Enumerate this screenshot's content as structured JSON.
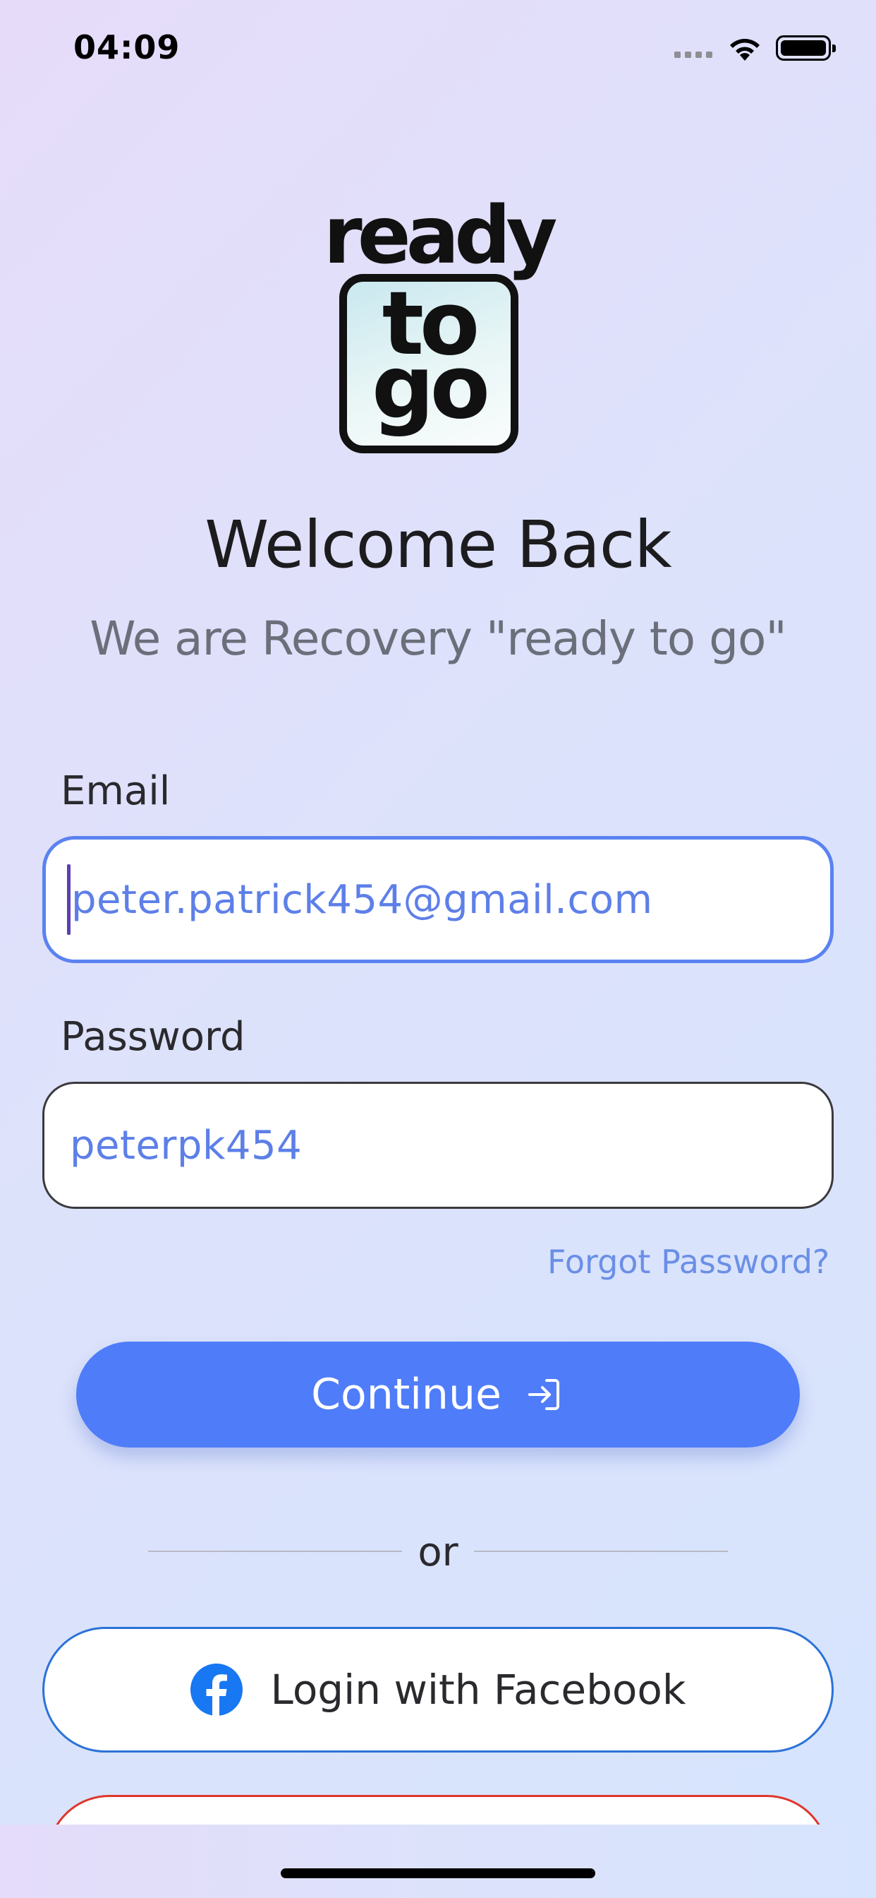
{
  "status_bar": {
    "time": "04:09"
  },
  "logo": {
    "top_word": "ready",
    "box_line1": "to",
    "box_line2": "go"
  },
  "header": {
    "title": "Welcome Back",
    "subtitle": "We are Recovery \"ready to go\""
  },
  "form": {
    "email_label": "Email",
    "email_value": "peter.patrick454@gmail.com",
    "password_label": "Password",
    "password_value": "peterpk454",
    "forgot_password": "Forgot Password?"
  },
  "continue_button": {
    "label": "Continue",
    "icon": "login-arrow-icon"
  },
  "divider": {
    "text": "or"
  },
  "social": {
    "facebook_label": "Login with Facebook",
    "facebook_icon": "facebook-icon"
  },
  "colors": {
    "accent": "#4f7cf8",
    "link": "#6a8fe6",
    "facebook": "#1877f2",
    "google_border": "#e0352b"
  }
}
